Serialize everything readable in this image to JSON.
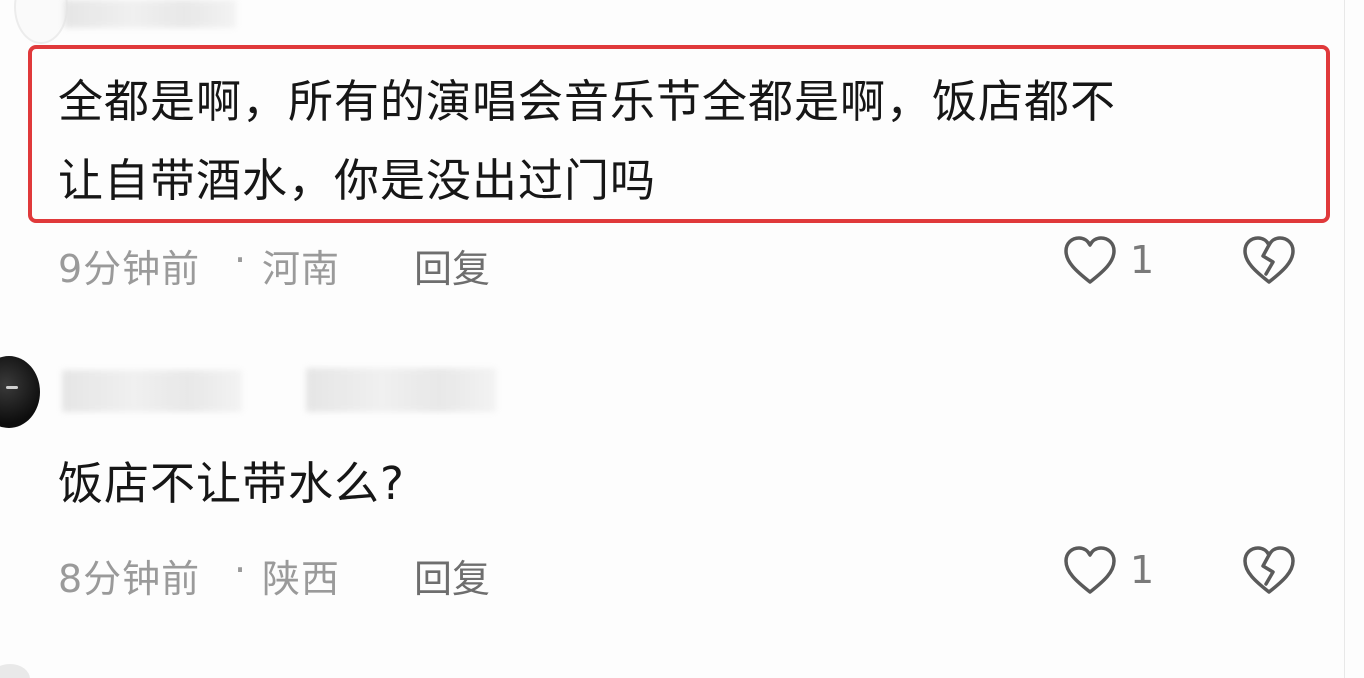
{
  "comments": [
    {
      "text_line1": "全都是啊，所有的演唱会音乐节全都是啊，饭店都不",
      "text_line2": "让自带酒水，你是没出过门吗",
      "time": "9分钟前",
      "separator": "·",
      "location": "河南",
      "reply_label": "回复",
      "like_count": "1",
      "highlighted": true,
      "highlight_color": "#e0393b"
    },
    {
      "text_line1": "饭店不让带水么?",
      "time": "8分钟前",
      "separator": "·",
      "location": "陕西",
      "reply_label": "回复",
      "like_count": "1",
      "highlighted": false
    }
  ],
  "icons": {
    "like": "heart-outline-icon",
    "dislike": "broken-heart-icon"
  },
  "colors": {
    "text": "#161616",
    "meta": "#9a9a9a",
    "highlight": "#e0393b"
  }
}
